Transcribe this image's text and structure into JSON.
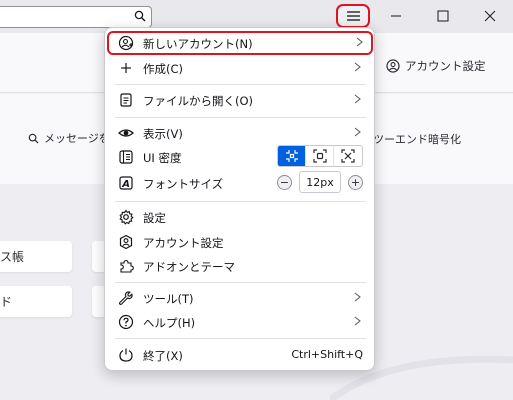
{
  "window": {
    "search_placeholder": "",
    "minimize_icon": "minimize-icon",
    "maximize_icon": "maximize-icon",
    "close_icon": "close-icon"
  },
  "toolbar": {
    "account_settings": "アカウント設定"
  },
  "content": {
    "search_messages": "メッセージを検",
    "e2e": "ツーエンド暗号化",
    "card1": "ス帳",
    "card2": "ド"
  },
  "menu": {
    "new_account": "新しいアカウント(N)",
    "create": "作成(C)",
    "open_file": "ファイルから開く(O)",
    "view": "表示(V)",
    "ui_density": "UI 密度",
    "font_size": "フォントサイズ",
    "font_size_value": "12px",
    "font_minus": "−",
    "font_plus": "+",
    "settings": "設定",
    "account_settings": "アカウント設定",
    "addons": "アドオンとテーマ",
    "tools": "ツール(T)",
    "help": "ヘルプ(H)",
    "quit": "終了(X)",
    "quit_shortcut": "Ctrl+Shift+Q"
  },
  "colors": {
    "highlight_border": "#e0141e",
    "accent_blue": "#0061e0"
  }
}
